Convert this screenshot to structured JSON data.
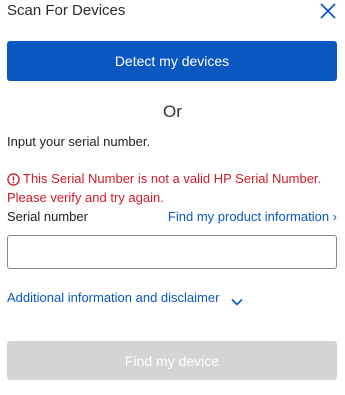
{
  "header": {
    "title": "Scan For Devices",
    "close_icon": "close-icon"
  },
  "detect": {
    "button_label": "Detect my devices"
  },
  "divider": {
    "or_text": "Or"
  },
  "instruction": "Input your serial number.",
  "error": {
    "icon": "error-circle-icon",
    "line1": "This Serial Number is not a valid HP Serial Number.",
    "line2": "Please verify and try again."
  },
  "serial": {
    "label": "Serial number",
    "product_link": "Find my product information ›",
    "value": "",
    "placeholder": ""
  },
  "disclaimer": {
    "label": "Additional information and disclaimer",
    "icon": "chevron-down-icon"
  },
  "find": {
    "button_label": "Find my device",
    "disabled": true
  },
  "colors": {
    "primary": "#0a57c2",
    "error": "#d11a2a",
    "disabled": "#d4d4d4"
  }
}
